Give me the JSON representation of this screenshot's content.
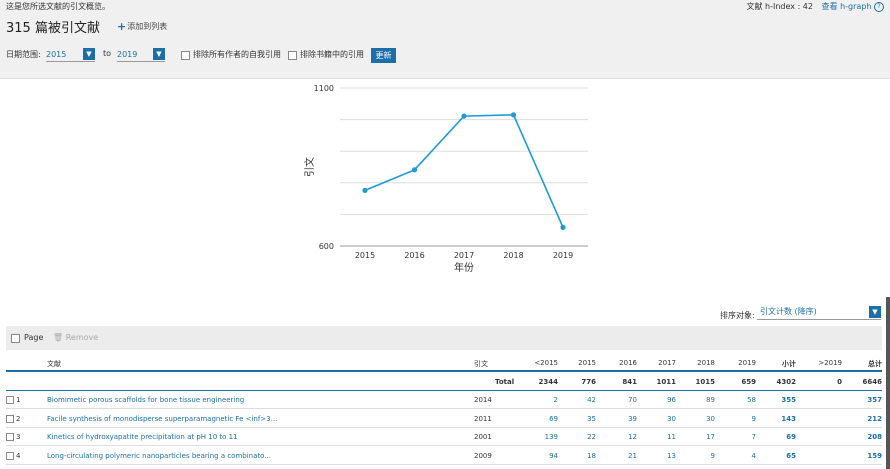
{
  "header": {
    "intro": "这是您所选文献的引文概览。",
    "hindex_label": "文献 h-Index : 42",
    "hgraph_link": "查看 h-graph",
    "help": "?",
    "title": "315 篇被引文献",
    "add_to_list": "添加到列表"
  },
  "filters": {
    "date_range_label": "日期范围:",
    "from_value": "2015",
    "to_label": "to",
    "to_value": "2019",
    "exclude_self_label": "排除所有作者的自我引用",
    "exclude_books_label": "排除书籍中的引用",
    "update_label": "更新"
  },
  "chart_data": {
    "type": "line",
    "categories": [
      "2015",
      "2016",
      "2017",
      "2018",
      "2019"
    ],
    "series": [
      {
        "values": [
          776,
          841,
          1011,
          1015,
          659
        ]
      }
    ],
    "ylim": [
      600,
      1100
    ],
    "ytick_labels": [
      "600",
      "1100"
    ],
    "xlabel": "年份",
    "ylabel": "引文",
    "color": "#1f9bd1",
    "grid": true
  },
  "sort": {
    "label": "排序对象:",
    "value": "引文计数 (降序)"
  },
  "table_toolbar": {
    "page_label": "Page",
    "remove_label": "Remove"
  },
  "table": {
    "headers": [
      "文献",
      "引文",
      "<2015",
      "2015",
      "2016",
      "2017",
      "2018",
      "2019",
      "小计",
      ">2019",
      "总计"
    ],
    "total_row": {
      "label": "Total",
      "values": [
        "2344",
        "776",
        "841",
        "1011",
        "1015",
        "659",
        "4302",
        "0",
        "6646"
      ]
    },
    "rows": [
      {
        "idx": "1",
        "title": "Biomimetic porous scaffolds for bone tissue engineering",
        "year": "2014",
        "values": [
          "2",
          "42",
          "70",
          "96",
          "89",
          "58",
          "355",
          "",
          "357"
        ]
      },
      {
        "idx": "2",
        "title": "Facile synthesis of monodisperse superparamagnetic Fe <inf>3...",
        "year": "2011",
        "values": [
          "69",
          "35",
          "39",
          "30",
          "30",
          "9",
          "143",
          "",
          "212"
        ]
      },
      {
        "idx": "3",
        "title": "Kinetics of hydroxyapatite precipitation at pH 10 to 11",
        "year": "2001",
        "values": [
          "139",
          "22",
          "12",
          "11",
          "17",
          "7",
          "69",
          "",
          "208"
        ]
      },
      {
        "idx": "4",
        "title": "Long-circulating polymeric nanoparticles bearing a combinato...",
        "year": "2009",
        "values": [
          "94",
          "18",
          "21",
          "13",
          "9",
          "4",
          "65",
          "",
          "159"
        ]
      }
    ]
  }
}
